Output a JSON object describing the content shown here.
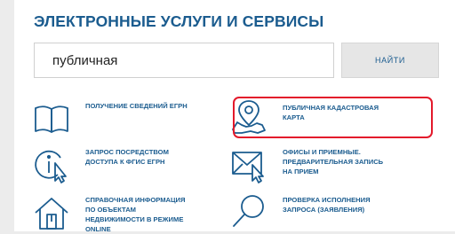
{
  "header": {
    "title": "ЭЛЕКТРОННЫЕ УСЛУГИ И СЕРВИСЫ"
  },
  "search": {
    "value": "публичная",
    "button_label": "НАЙТИ"
  },
  "services": {
    "egrn_info": {
      "label_lines": [
        "ПОЛУЧЕНИЕ СВЕДЕНИЙ ЕГРН"
      ],
      "icon": "open-book-icon"
    },
    "public_map": {
      "label_lines": [
        "ПУБЛИЧНАЯ КАДАСТРОВАЯ",
        "КАРТА"
      ],
      "icon": "map-pin-icon"
    },
    "fgis_request": {
      "label_lines": [
        "ЗАПРОС ПОСРЕДСТВОМ",
        "ДОСТУПА К ФГИС ЕГРН"
      ],
      "icon": "info-cursor-icon"
    },
    "offices": {
      "label_lines": [
        "ОФИСЫ И ПРИЕМНЫЕ.",
        "ПРЕДВАРИТЕЛЬНАЯ ЗАПИСЬ",
        "НА ПРИЕМ"
      ],
      "icon": "envelope-cursor-icon"
    },
    "reference_info": {
      "label_lines": [
        "СПРАВОЧНАЯ ИНФОРМАЦИЯ",
        "ПО ОБЪЕКТАМ",
        "НЕДВИЖИМОСТИ В РЕЖИМЕ",
        "ONLINE"
      ],
      "icon": "house-icon"
    },
    "request_status": {
      "label_lines": [
        "ПРОВЕРКА ИСПОЛНЕНИЯ",
        "ЗАПРОСА (ЗАЯВЛЕНИЯ)"
      ],
      "icon": "magnifier-icon"
    }
  },
  "colors": {
    "accent": "#1b5c8f",
    "highlight": "#e3192b",
    "background": "#ececec",
    "button_bg": "#e6e6e6"
  }
}
